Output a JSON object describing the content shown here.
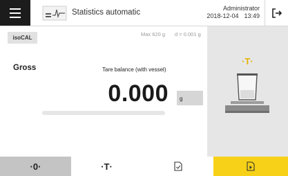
{
  "header": {
    "menu_icon": "hamburger-menu-icon",
    "task_icon": "statistics-icon",
    "task_title": "Statistics automatic",
    "user": "Administrator",
    "date": "2018-12-04",
    "time": "13:49",
    "logout_icon": "logout-icon"
  },
  "weighing": {
    "isocal_label": "isoCAL",
    "capacity_max": "Max 620 g",
    "capacity_d": "d = 0.001 g",
    "mode_label": "Gross",
    "instruction": "Tare balance (with vessel)",
    "value": "0.000",
    "unit": "g",
    "progress": 0
  },
  "side_panel": {
    "tare_indicator": "·T·",
    "graphic_icon": "balance-with-vessel-icon"
  },
  "bottom_bar": {
    "zero_label": "·0·",
    "tare_label": "·T·",
    "doc_icon": "document-check-icon",
    "result_icon": "document-play-icon"
  },
  "colors": {
    "accent_yellow": "#f7d117",
    "tare_yellow": "#e7b300",
    "menu_dark": "#1c1c1c",
    "panel_grey": "#e6e6e6"
  }
}
